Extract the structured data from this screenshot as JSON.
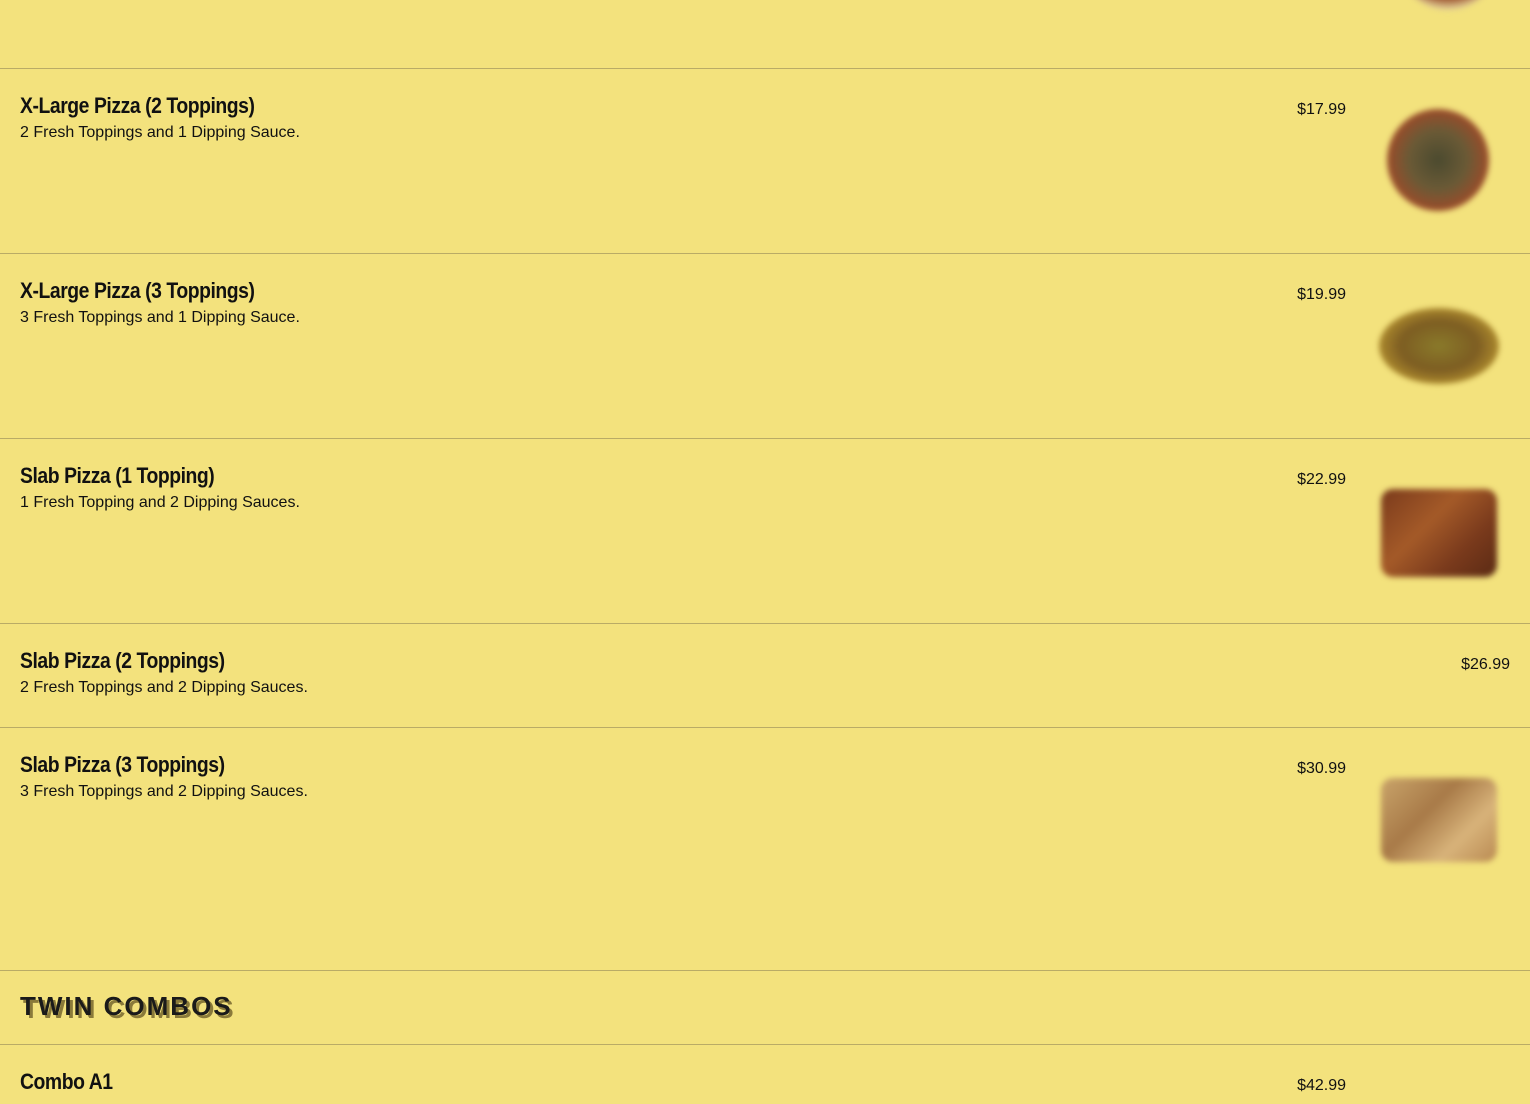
{
  "menu": {
    "items": [
      {
        "title": "X-Large Pizza (2 Toppings)",
        "description": "2 Fresh Toppings and 1 Dipping Sauce.",
        "price": "$17.99",
        "photo": "round-pizza-photo"
      },
      {
        "title": "X-Large Pizza (3 Toppings)",
        "description": "3 Fresh Toppings and 1 Dipping Sauce.",
        "price": "$19.99",
        "photo": "round-pizza-photo"
      },
      {
        "title": "Slab Pizza (1 Topping)",
        "description": "1 Fresh Topping and 2 Dipping Sauces.",
        "price": "$22.99",
        "photo": "slab-pizza-photo"
      },
      {
        "title": "Slab Pizza (2 Toppings)",
        "description": "2 Fresh Toppings and 2 Dipping Sauces.",
        "price": "$26.99",
        "photo": ""
      },
      {
        "title": "Slab Pizza (3 Toppings)",
        "description": "3 Fresh Toppings and 2 Dipping Sauces.",
        "price": "$30.99",
        "photo": "slab-pizza-photo"
      }
    ],
    "section": {
      "title": "TWIN COMBOS"
    },
    "next_item": {
      "title": "Combo A1",
      "price": "$42.99"
    }
  },
  "colors": {
    "background": "#f3e27d",
    "divider": "#b9ab66",
    "text": "#111111"
  }
}
